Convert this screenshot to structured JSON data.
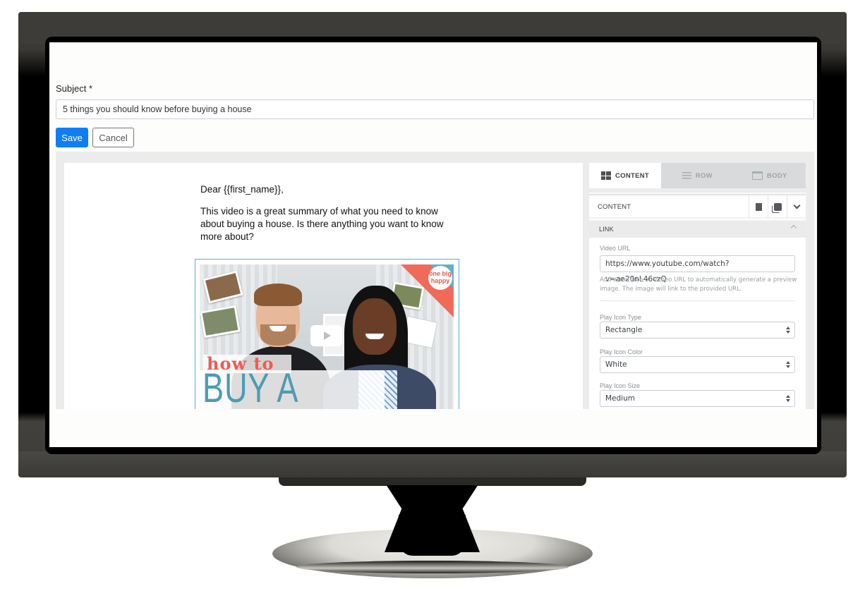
{
  "form": {
    "subject_label": "Subject *",
    "subject_value": "5 things you should know before buying a house",
    "save_label": "Save",
    "cancel_label": "Cancel"
  },
  "email": {
    "greeting": "Dear {{first_name}},",
    "body": "This video is a great summary of what you need to know about buying a house. Is there anything you want to know more about?",
    "video": {
      "overlay_line1": "how to",
      "overlay_line2": "BUY A HOUSE",
      "logo_text": "one big happy",
      "play_icon": "play-icon",
      "move_icon": "move-icon"
    }
  },
  "panel": {
    "tabs": [
      {
        "label": "CONTENT",
        "icon": "grid-icon",
        "active": true
      },
      {
        "label": "ROW",
        "icon": "rows-icon",
        "active": false
      },
      {
        "label": "BODY",
        "icon": "body-icon",
        "active": false
      }
    ],
    "content_title": "CONTENT",
    "actions": [
      "trash-icon",
      "duplicate-icon",
      "chevron-down-icon"
    ],
    "section_title": "LINK",
    "fields": {
      "video_url_label": "Video URL",
      "video_url_value": "https://www.youtube.com/watch?v=ae20nL46czQ",
      "help_text": "Add a YouTube or Vimeo URL to automatically generate a preview image. The image will link to the provided URL.",
      "play_icon_type_label": "Play Icon Type",
      "play_icon_type_value": "Rectangle",
      "play_icon_color_label": "Play Icon Color",
      "play_icon_color_value": "White",
      "play_icon_size_label": "Play Icon Size",
      "play_icon_size_value": "Medium"
    }
  },
  "colors": {
    "primary": "#0f7ef5",
    "selection": "#52aee0",
    "accent_red": "#f25a50",
    "accent_teal": "#4d9bb6"
  }
}
